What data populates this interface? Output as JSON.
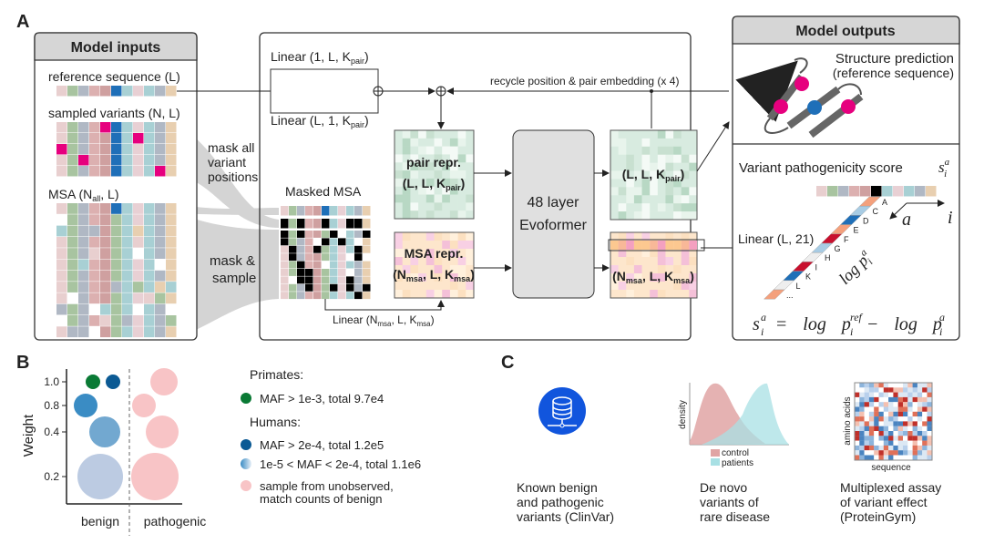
{
  "panelA": {
    "label": "A",
    "inputs": {
      "title": "Model inputs",
      "reference_sequence": "reference sequence (L)",
      "sampled_variants": "sampled variants (N, L)",
      "msa": "MSA (N",
      "msa_sub": "all",
      "msa_end": ", L)"
    },
    "mask_all": [
      "mask all",
      "variant",
      "positions"
    ],
    "mask_sample": [
      "mask &",
      "sample"
    ],
    "masked_msa": "Masked MSA",
    "linear_1": {
      "text": "Linear (1, L, K",
      "sub": "pair",
      "end": ")"
    },
    "linear_2": {
      "text": "Linear (L, 1, K",
      "sub": "pair",
      "end": ")"
    },
    "linear_msa": {
      "text": "Linear (N",
      "sub1": "msa",
      "mid": ", L, K",
      "sub2": "msa",
      "end": ")"
    },
    "recycle": "recycle position & pair embedding (x 4)",
    "pair_repr": {
      "title": "pair repr.",
      "dims": "(L, L, K",
      "sub": "pair",
      "end": ")"
    },
    "msa_repr": {
      "title": "MSA repr.",
      "dims": "(N",
      "sub1": "msa",
      "mid": ", L, K",
      "sub2": "msa",
      "end": ")"
    },
    "evoformer": [
      "48 layer",
      "Evoformer"
    ],
    "out_pair": {
      "dims": "(L, L, K",
      "sub": "pair",
      "end": ")"
    },
    "out_msa": {
      "dims": "(N",
      "sub1": "msa",
      "mid": ", L, K",
      "sub2": "msa",
      "end": ")"
    },
    "outputs": {
      "title": "Model outputs",
      "structure": "Structure prediction",
      "structure_sub": "(reference sequence)",
      "score_title": "Variant pathogenicity score",
      "linear_21": "Linear (L, 21)",
      "amino_acids": [
        "A",
        "C",
        "D",
        "E",
        "F",
        "G",
        "H",
        "I",
        "K",
        "L",
        "..."
      ],
      "axis_a": "a",
      "axis_i": "i",
      "log_p": "log p",
      "formula": "s = log p − log p"
    },
    "colors": {
      "variant": "#e6007e",
      "reference_highlight": "#1f6fb8",
      "pair_repr": "#d8ebe0",
      "msa_repr": "#fde6cc"
    }
  },
  "panelB": {
    "label": "B",
    "ylabel": "Weight",
    "yticks": [
      "1.0",
      "0.8",
      "0.4",
      "0.2"
    ],
    "categories": [
      "benign",
      "pathogenic"
    ],
    "legend": {
      "primates": "Primates:",
      "primates_item": "MAF > 1e-3, total 9.7e4",
      "humans": "Humans:",
      "humans_item1": "MAF > 2e-4, total 1.2e5",
      "humans_item2": "1e-5 < MAF < 2e-4, total 1.1e6",
      "sample_item": [
        "sample from unobserved,",
        "match counts of benign"
      ]
    },
    "colors": {
      "primates": "#0a7a35",
      "human_common": "#0b5a94",
      "human_rare": "#3a8cc4",
      "sampled": "#f8c4c6"
    }
  },
  "panelC": {
    "label": "C",
    "clinvar": [
      "Known benign",
      "and pathogenic",
      "variants (ClinVar)"
    ],
    "denovo": [
      "De novo",
      "variants of",
      "rare disease"
    ],
    "density_ylabel": "density",
    "density_legend": [
      "control",
      "patients"
    ],
    "heatmap_xlabel": "sequence",
    "heatmap_ylabel": "amino acids",
    "mave": [
      "Multiplexed assay",
      "of variant effect",
      "(ProteinGym)"
    ],
    "icon": "database-icon",
    "colors": {
      "control": "#e0a4a4",
      "patients": "#a8e0e4",
      "database": "#1155dd"
    }
  }
}
